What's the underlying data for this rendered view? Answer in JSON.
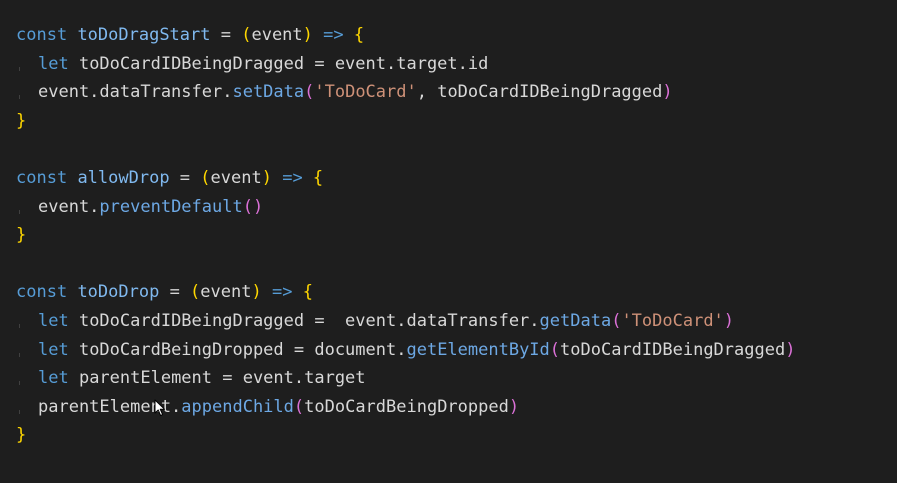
{
  "code": {
    "line1": {
      "kw": "const",
      "name": "toDoDragStart",
      "eq": " = ",
      "paren_open": "(",
      "param": "event",
      "paren_close": ")",
      "arrow": " => ",
      "brace": "{"
    },
    "line2": {
      "kw": "let",
      "var": " toDoCardIDBeingDragged = event.target.id"
    },
    "line3": {
      "obj": "event.dataTransfer.",
      "fn": "setData",
      "paren_open": "(",
      "str": "'ToDoCard'",
      "rest": ", toDoCardIDBeingDragged",
      "paren_close": ")"
    },
    "line4": {
      "brace": "}"
    },
    "line6": {
      "kw": "const",
      "name": "allowDrop",
      "eq": " = ",
      "paren_open": "(",
      "param": "event",
      "paren_close": ")",
      "arrow": " => ",
      "brace": "{"
    },
    "line7": {
      "obj": "event.",
      "fn": "preventDefault",
      "parens": "()"
    },
    "line8": {
      "brace": "}"
    },
    "line10": {
      "kw": "const",
      "name": "toDoDrop",
      "eq": " = ",
      "paren_open": "(",
      "param": "event",
      "paren_close": ")",
      "arrow": " => ",
      "brace": "{"
    },
    "line11": {
      "kw": "let",
      "var": " toDoCardIDBeingDragged =  event.dataTransfer.",
      "fn": "getData",
      "paren_open": "(",
      "str": "'ToDoCard'",
      "paren_close": ")"
    },
    "line12": {
      "kw": "let",
      "var": " toDoCardBeingDropped = document.",
      "fn": "getElementById",
      "paren_open": "(",
      "arg": "toDoCardIDBeingDragged",
      "paren_close": ")"
    },
    "line13": {
      "kw": "let",
      "var": " parentElement = event.target"
    },
    "line14": {
      "obj": "parentElement.",
      "fn": "appendChild",
      "paren_open": "(",
      "arg": "toDoCardBeingDropped",
      "paren_close": ")"
    },
    "line15": {
      "brace": "}"
    }
  },
  "icons": {
    "cursor": "mouse-pointer-icon"
  }
}
